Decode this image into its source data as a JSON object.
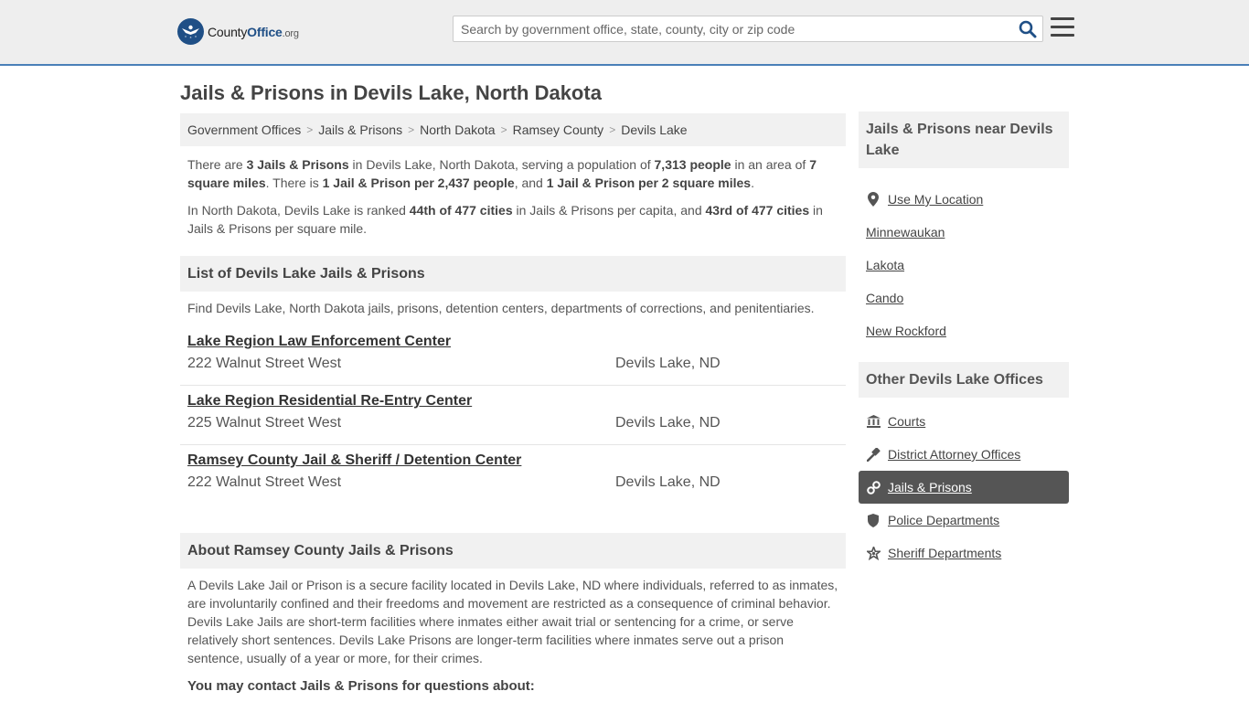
{
  "header": {
    "logo": {
      "prefix": "County",
      "brand": "Office",
      "suffix": ".org"
    },
    "search_placeholder": "Search by government office, state, county, city or zip code"
  },
  "page_title": "Jails & Prisons in Devils Lake, North Dakota",
  "breadcrumb": [
    "Government Offices",
    "Jails & Prisons",
    "North Dakota",
    "Ramsey County",
    "Devils Lake"
  ],
  "intro": {
    "p1": {
      "t1": "There are ",
      "count": "3 Jails & Prisons",
      "t2": " in Devils Lake, North Dakota, serving a population of ",
      "population": "7,313 people",
      "t3": " in an area of ",
      "area": "7 square miles",
      "t4": ". There is ",
      "per_people": "1 Jail & Prison per 2,437 people",
      "t5": ", and ",
      "per_area": "1 Jail & Prison per 2 square miles",
      "t6": "."
    },
    "p2": {
      "t1": "In North Dakota, Devils Lake is ranked ",
      "rank1": "44th of 477 cities",
      "t2": " in Jails & Prisons per capita, and ",
      "rank2": "43rd of 477 cities",
      "t3": " in Jails & Prisons per square mile."
    }
  },
  "list": {
    "heading": "List of Devils Lake Jails & Prisons",
    "intro": "Find Devils Lake, North Dakota jails, prisons, detention centers, departments of corrections, and penitentiaries.",
    "items": [
      {
        "name": "Lake Region Law Enforcement Center",
        "address": "222 Walnut Street West",
        "city": "Devils Lake, ND"
      },
      {
        "name": "Lake Region Residential Re-Entry Center",
        "address": "225 Walnut Street West",
        "city": "Devils Lake, ND"
      },
      {
        "name": "Ramsey County Jail & Sheriff / Detention Center",
        "address": "222 Walnut Street West",
        "city": "Devils Lake, ND"
      }
    ]
  },
  "about": {
    "heading": "About Ramsey County Jails & Prisons",
    "text": "A Devils Lake Jail or Prison is a secure facility located in Devils Lake, ND where individuals, referred to as inmates, are involuntarily confined and their freedoms and movement are restricted as a consequence of criminal behavior. Devils Lake Jails are short-term facilities where inmates either await trial or sentencing for a crime, or serve relatively short sentences. Devils Lake Prisons are longer-term facilities where inmates serve out a prison sentence, usually of a year or more, for their crimes.",
    "contact_heading": "You may contact Jails & Prisons for questions about:"
  },
  "sidebar": {
    "near_heading": "Jails & Prisons near Devils Lake",
    "use_location": {
      "label": "Use My Location",
      "icon": "map-pin-icon"
    },
    "near": [
      "Minnewaukan",
      "Lakota",
      "Cando",
      "New Rockford"
    ],
    "other_heading": "Other Devils Lake Offices",
    "offices": [
      {
        "label": "Courts",
        "icon": "courthouse-icon"
      },
      {
        "label": "District Attorney Offices",
        "icon": "gavel-icon"
      },
      {
        "label": "Jails & Prisons",
        "icon": "handcuffs-icon",
        "active": true
      },
      {
        "label": "Police Departments",
        "icon": "shield-icon"
      },
      {
        "label": "Sheriff Departments",
        "icon": "star-badge-icon"
      }
    ]
  },
  "colors": {
    "brand": "#1f4f86",
    "active_bg": "#555555",
    "panel_bg": "#f1f1f1",
    "header_bg": "#eeeeee"
  }
}
